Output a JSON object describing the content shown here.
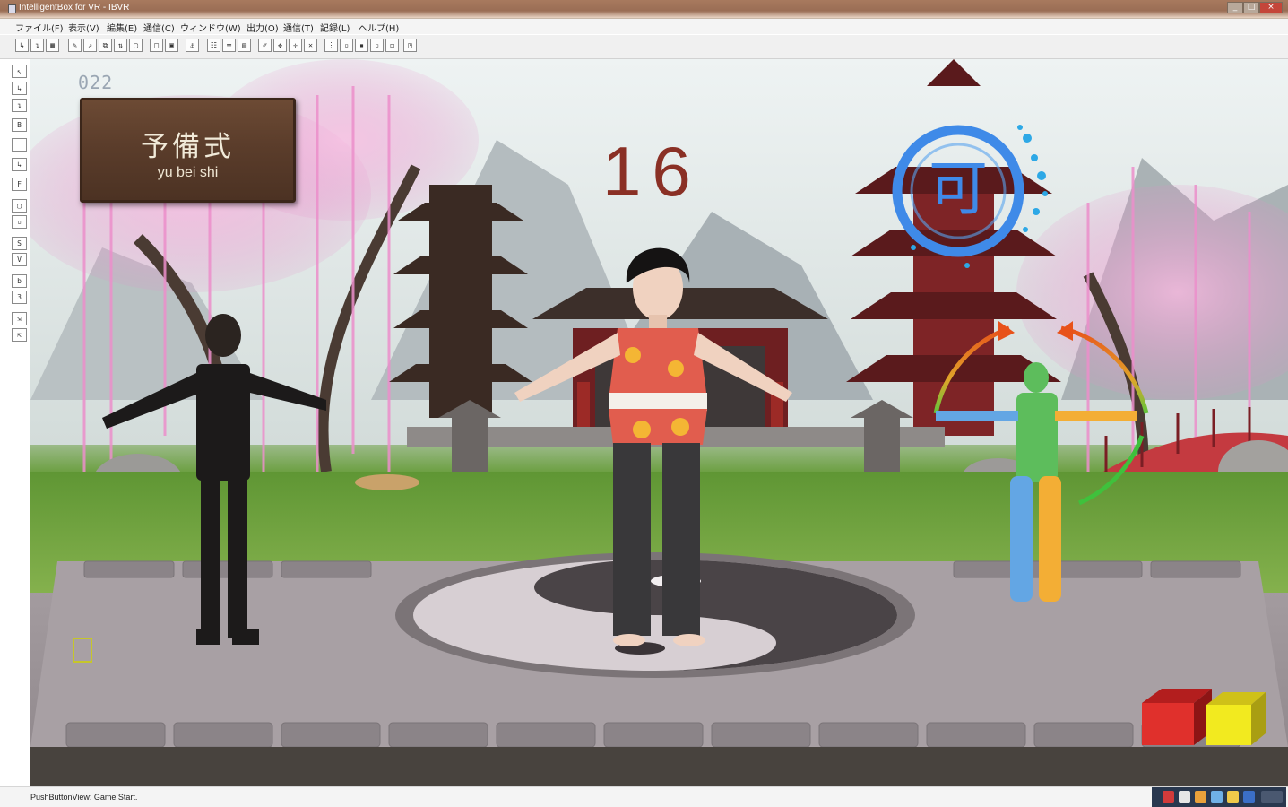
{
  "window": {
    "title": "IntelligentBox for VR - IBVR"
  },
  "menu": {
    "items": [
      "ファイル(F)",
      "表示(V)",
      "編集(E)",
      "通信(C)",
      "ウィンドウ(W)",
      "出力(O)",
      "通信(T)",
      "記録(L)",
      "ヘルプ(H)"
    ]
  },
  "game": {
    "score_counter": "022",
    "pose_name_kanji": "予備式",
    "pose_name_romaji": "yu bei shi",
    "countdown": "16",
    "judgement_glyph": "可",
    "colors": {
      "countdown": "#8a3025",
      "judgement_circle": "#3f8ae8",
      "guide_arrow_orange": "#e06b1d",
      "cube_red": "#e0302c",
      "cube_yellow": "#f2ea1f"
    }
  },
  "status": {
    "text": "PushButtonView: Game Start."
  }
}
